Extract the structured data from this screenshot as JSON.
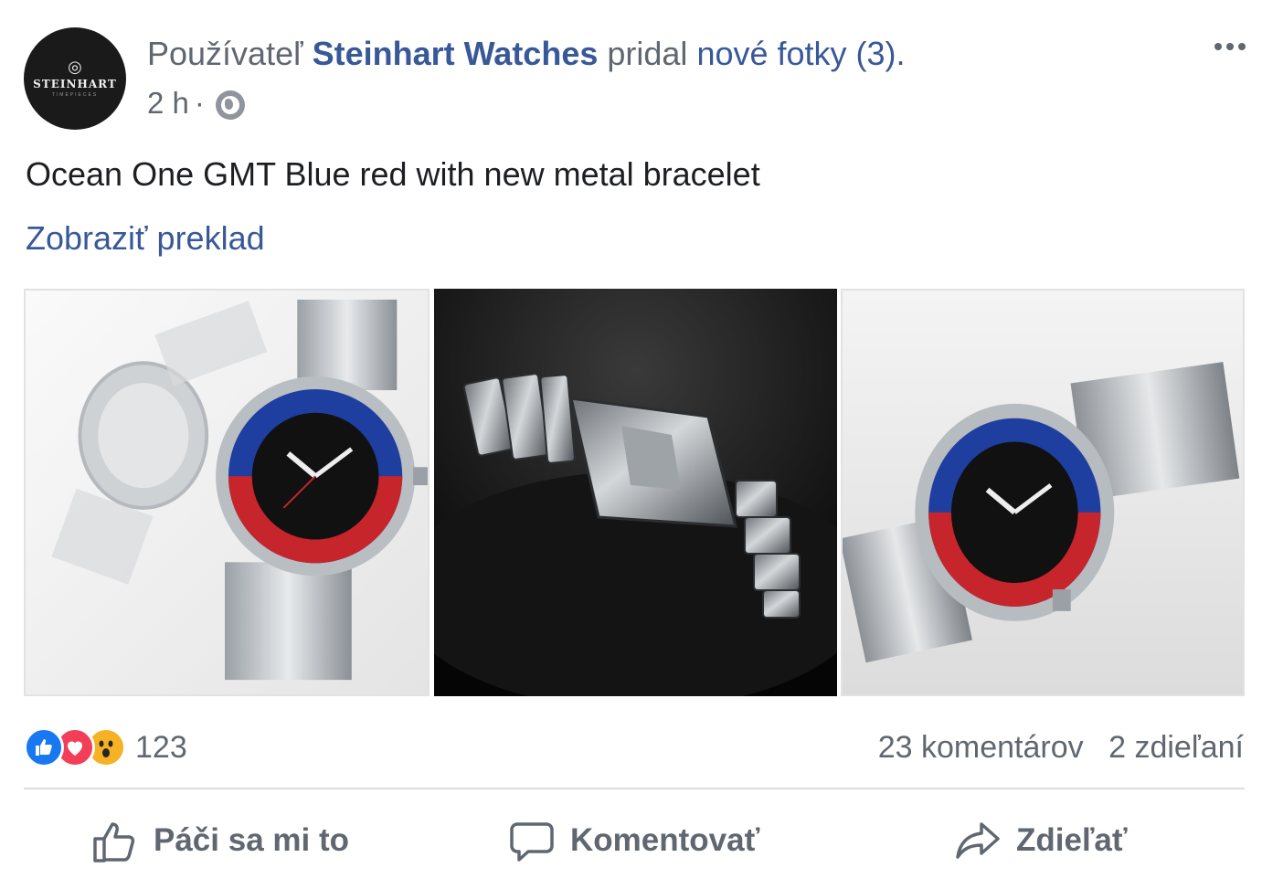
{
  "post": {
    "author_prefix": "Používateľ",
    "author_name": "Steinhart Watches",
    "action_text": "pridal",
    "action_link": "nové fotky (3).",
    "timestamp": "2 h",
    "separator": "·",
    "privacy_icon": "globe-icon",
    "more_icon": "more-options-icon",
    "text": "Ocean One GMT Blue red with new metal bracelet",
    "translate_label": "Zobraziť preklad"
  },
  "avatar": {
    "brand": "STEINHART",
    "tagline": "TIMEPIECES"
  },
  "photos": [
    {
      "name": "photo-watch-front-back"
    },
    {
      "name": "photo-bracelet-clasp"
    },
    {
      "name": "photo-watch-angled"
    }
  ],
  "reactions": {
    "icons": [
      "like-icon",
      "love-icon",
      "wow-icon"
    ],
    "count": "123",
    "comments": "23 komentárov",
    "shares": "2 zdieľaní"
  },
  "actions": {
    "like": "Páči sa mi to",
    "comment": "Komentovať",
    "share": "Zdieľať"
  },
  "colors": {
    "link": "#385898",
    "secondary_text": "#606770",
    "like": "#1877f2",
    "love": "#f33e58",
    "wow": "#f7b125",
    "divider": "#dadde1"
  }
}
